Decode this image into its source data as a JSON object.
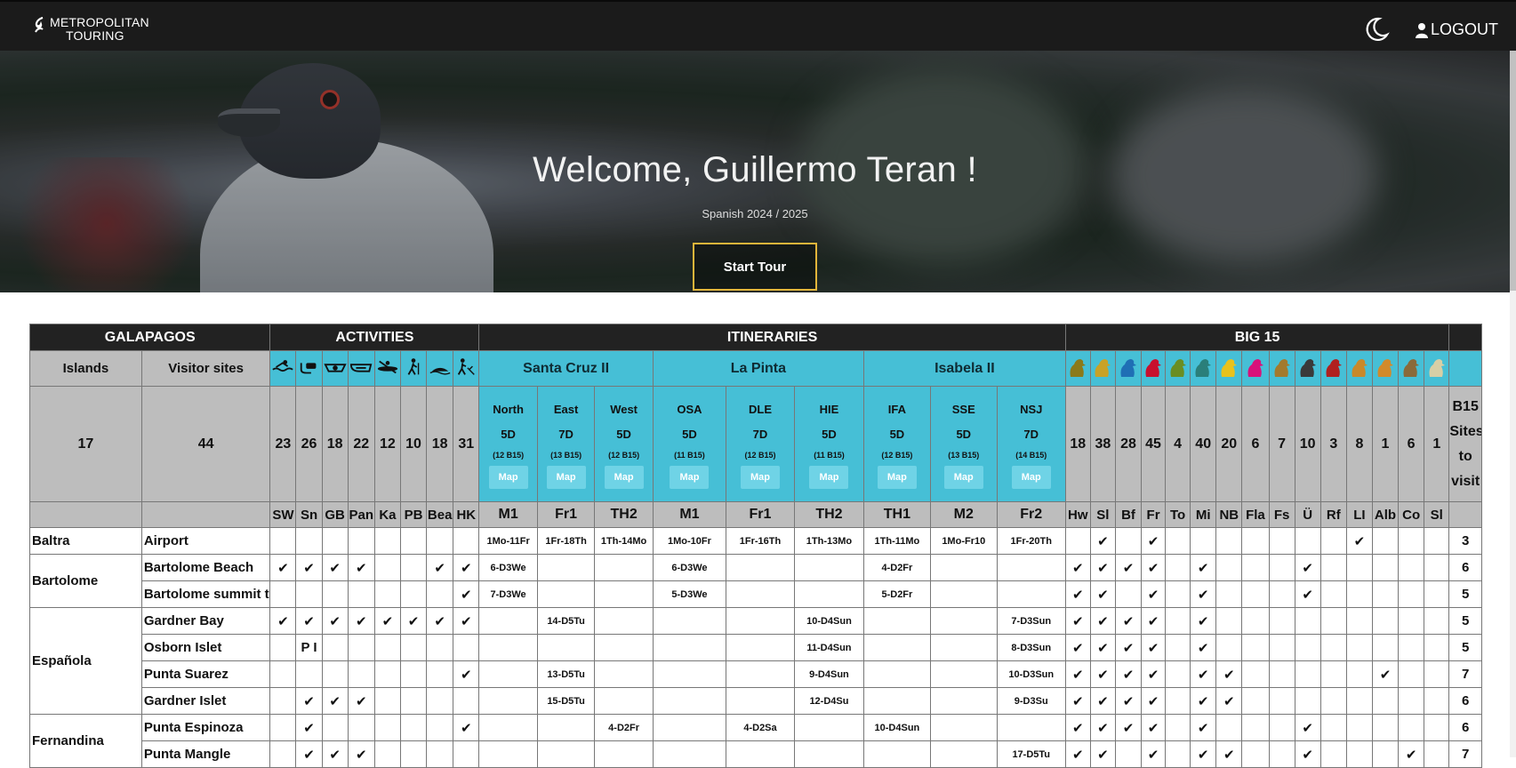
{
  "topbar": {
    "logo_line1": "METROPOLITAN",
    "logo_line2": "TOURING",
    "logout_label": "LOGOUT"
  },
  "hero": {
    "title": "Welcome, Guillermo Teran !",
    "subtitle": "Spanish 2024 / 2025",
    "start_tour_label": "Start Tour"
  },
  "table": {
    "groups": {
      "galapagos": "GALAPAGOS",
      "activities": "ACTIVITIES",
      "itineraries": "ITINERARIES",
      "big15": "BIG 15"
    },
    "col_islands": "Islands",
    "col_sites": "Visitor sites",
    "islands_count": "17",
    "sites_count": "44",
    "b15_sites_label": "B15 Sites to visit",
    "map_label": "Map",
    "ships": [
      {
        "name": "Santa Cruz II",
        "itins": [
          {
            "name": "North",
            "days": "5D",
            "b15": "(12 B15)",
            "code": "M1"
          },
          {
            "name": "East",
            "days": "7D",
            "b15": "(13 B15)",
            "code": "Fr1"
          },
          {
            "name": "West",
            "days": "5D",
            "b15": "(12 B15)",
            "code": "TH2"
          }
        ]
      },
      {
        "name": "La Pinta",
        "itins": [
          {
            "name": "OSA",
            "days": "5D",
            "b15": "(11 B15)",
            "code": "M1"
          },
          {
            "name": "DLE",
            "days": "7D",
            "b15": "(12 B15)",
            "code": "Fr1"
          },
          {
            "name": "HIE",
            "days": "5D",
            "b15": "(11 B15)",
            "code": "TH2"
          }
        ]
      },
      {
        "name": "Isabela II",
        "itins": [
          {
            "name": "IFA",
            "days": "5D",
            "b15": "(12 B15)",
            "code": "TH1"
          },
          {
            "name": "SSE",
            "days": "5D",
            "b15": "(13 B15)",
            "code": "M2"
          },
          {
            "name": "NSJ",
            "days": "7D",
            "b15": "(14 B15)",
            "code": "Fr2"
          }
        ]
      }
    ],
    "activities": [
      {
        "code": "SW",
        "count": "23",
        "icon": "swim-icon"
      },
      {
        "code": "Sn",
        "count": "26",
        "icon": "snorkel-icon"
      },
      {
        "code": "GB",
        "count": "18",
        "icon": "glass-bottom-boat-icon"
      },
      {
        "code": "Pan",
        "count": "22",
        "icon": "panga-ride-icon"
      },
      {
        "code": "Ka",
        "count": "12",
        "icon": "kayak-icon"
      },
      {
        "code": "PB",
        "count": "10",
        "icon": "hiking-icon"
      },
      {
        "code": "Bea",
        "count": "18",
        "icon": "beach-icon"
      },
      {
        "code": "HK",
        "count": "31",
        "icon": "hike-icon"
      }
    ],
    "big15": [
      {
        "code": "Hw",
        "count": "18",
        "icon": "hawk-icon",
        "color": "#8b7a1a"
      },
      {
        "code": "Sl",
        "count": "38",
        "icon": "sea-lion-icon",
        "color": "#c9a227"
      },
      {
        "code": "Bf",
        "count": "28",
        "icon": "booby-icon",
        "color": "#1f6fb5"
      },
      {
        "code": "Fr",
        "count": "45",
        "icon": "frigatebird-icon",
        "color": "#c8102e"
      },
      {
        "code": "To",
        "count": "4",
        "icon": "tortoise-icon",
        "color": "#6a8e23"
      },
      {
        "code": "Mi",
        "count": "40",
        "icon": "marine-iguana-icon",
        "color": "#2a7f7a"
      },
      {
        "code": "NB",
        "count": "20",
        "icon": "nazca-booby-icon",
        "color": "#e8c21c"
      },
      {
        "code": "Fla",
        "count": "6",
        "icon": "flamingo-icon",
        "color": "#d8127a"
      },
      {
        "code": "Fs",
        "count": "7",
        "icon": "fur-seal-icon",
        "color": "#a37a2d"
      },
      {
        "code": "Ü",
        "count": "10",
        "icon": "penguin-icon",
        "color": "#3a3a3a"
      },
      {
        "code": "Rf",
        "count": "3",
        "icon": "red-footed-booby-icon",
        "color": "#b02020"
      },
      {
        "code": "LI",
        "count": "8",
        "icon": "land-iguana-icon",
        "color": "#c8892a"
      },
      {
        "code": "Alb",
        "count": "1",
        "icon": "albatross-icon",
        "color": "#d28a2a"
      },
      {
        "code": "Co",
        "count": "6",
        "icon": "cormorant-icon",
        "color": "#8a6a3a"
      },
      {
        "code": "Sl",
        "count": "1",
        "icon": "lava-lizard-icon",
        "color": "#d8cfa6"
      }
    ],
    "rows": [
      {
        "island": "Baltra",
        "span": 1,
        "site": "Airport",
        "acts": [
          "",
          "",
          "",
          "",
          "",
          "",
          "",
          ""
        ],
        "itins": [
          "1Mo-11Fr",
          "1Fr-18Th",
          "1Th-14Mo",
          "1Mo-10Fr",
          "1Fr-16Th",
          "1Th-13Mo",
          "1Th-11Mo",
          "1Mo-Fr10",
          "1Fr-20Th"
        ],
        "b15": [
          "",
          "✔",
          "",
          "✔",
          "",
          "",
          "",
          "",
          "",
          "",
          "",
          "✔",
          "",
          "",
          ""
        ],
        "total": "3"
      },
      {
        "island": "Bartolome",
        "span": 2,
        "site": "Bartolome Beach",
        "acts": [
          "✔",
          "✔",
          "✔",
          "✔",
          "",
          "",
          "✔",
          "✔"
        ],
        "itins": [
          "6-D3We",
          "",
          "",
          "6-D3We",
          "",
          "",
          "4-D2Fr",
          "",
          ""
        ],
        "b15": [
          "✔",
          "✔",
          "✔",
          "✔",
          "",
          "✔",
          "",
          "",
          "",
          "✔",
          "",
          "",
          "",
          "",
          ""
        ],
        "total": "6"
      },
      {
        "island": "",
        "span": 0,
        "site": "Bartolome summit trail",
        "acts": [
          "",
          "",
          "",
          "",
          "",
          "",
          "",
          "✔"
        ],
        "itins": [
          "7-D3We",
          "",
          "",
          "5-D3We",
          "",
          "",
          "5-D2Fr",
          "",
          ""
        ],
        "b15": [
          "✔",
          "✔",
          "",
          "✔",
          "",
          "✔",
          "",
          "",
          "",
          "✔",
          "",
          "",
          "",
          "",
          ""
        ],
        "total": "5"
      },
      {
        "island": "Española",
        "span": 4,
        "site": "Gardner Bay",
        "acts": [
          "✔",
          "✔",
          "✔",
          "✔",
          "✔",
          "✔",
          "✔",
          "✔"
        ],
        "itins": [
          "",
          "14-D5Tu",
          "",
          "",
          "",
          "10-D4Sun",
          "",
          "",
          "7-D3Sun"
        ],
        "b15": [
          "✔",
          "✔",
          "✔",
          "✔",
          "",
          "✔",
          "",
          "",
          "",
          "",
          "",
          "",
          "",
          "",
          ""
        ],
        "total": "5"
      },
      {
        "island": "",
        "span": 0,
        "site": "Osborn Islet",
        "acts": [
          "",
          "P I",
          "",
          "",
          "",
          "",
          "",
          ""
        ],
        "itins": [
          "",
          "",
          "",
          "",
          "",
          "11-D4Sun",
          "",
          "",
          "8-D3Sun"
        ],
        "b15": [
          "✔",
          "✔",
          "✔",
          "✔",
          "",
          "✔",
          "",
          "",
          "",
          "",
          "",
          "",
          "",
          "",
          ""
        ],
        "total": "5"
      },
      {
        "island": "",
        "span": 0,
        "site": "Punta Suarez",
        "acts": [
          "",
          "",
          "",
          "",
          "",
          "",
          "",
          "✔"
        ],
        "itins": [
          "",
          "13-D5Tu",
          "",
          "",
          "",
          "9-D4Sun",
          "",
          "",
          "10-D3Sun"
        ],
        "b15": [
          "✔",
          "✔",
          "✔",
          "✔",
          "",
          "✔",
          "✔",
          "",
          "",
          "",
          "",
          "",
          "✔",
          "",
          ""
        ],
        "total": "7"
      },
      {
        "island": "",
        "span": 0,
        "site": "Gardner Islet",
        "acts": [
          "",
          "✔",
          "✔",
          "✔",
          "",
          "",
          "",
          ""
        ],
        "itins": [
          "",
          "15-D5Tu",
          "",
          "",
          "",
          "12-D4Su",
          "",
          "",
          "9-D3Su"
        ],
        "b15": [
          "✔",
          "✔",
          "✔",
          "✔",
          "",
          "✔",
          "✔",
          "",
          "",
          "",
          "",
          "",
          "",
          "",
          ""
        ],
        "total": "6"
      },
      {
        "island": "Fernandina",
        "span": 2,
        "site": "Punta Espinoza",
        "acts": [
          "",
          "✔",
          "",
          "",
          "",
          "",
          "",
          "✔"
        ],
        "itins": [
          "",
          "",
          "4-D2Fr",
          "",
          "4-D2Sa",
          "",
          "10-D4Sun",
          "",
          ""
        ],
        "b15": [
          "✔",
          "✔",
          "✔",
          "✔",
          "",
          "✔",
          "",
          "",
          "",
          "✔",
          "",
          "",
          "",
          "",
          ""
        ],
        "total": "6"
      },
      {
        "island": "",
        "span": 0,
        "site": "Punta Mangle",
        "acts": [
          "",
          "✔",
          "✔",
          "✔",
          "",
          "",
          "",
          ""
        ],
        "itins": [
          "",
          "",
          "",
          "",
          "",
          "",
          "",
          "",
          "17-D5Tu"
        ],
        "b15": [
          "✔",
          "✔",
          "",
          "✔",
          "",
          "✔",
          "✔",
          "",
          "",
          "✔",
          "",
          "",
          "",
          "✔",
          ""
        ],
        "total": "7"
      }
    ]
  }
}
